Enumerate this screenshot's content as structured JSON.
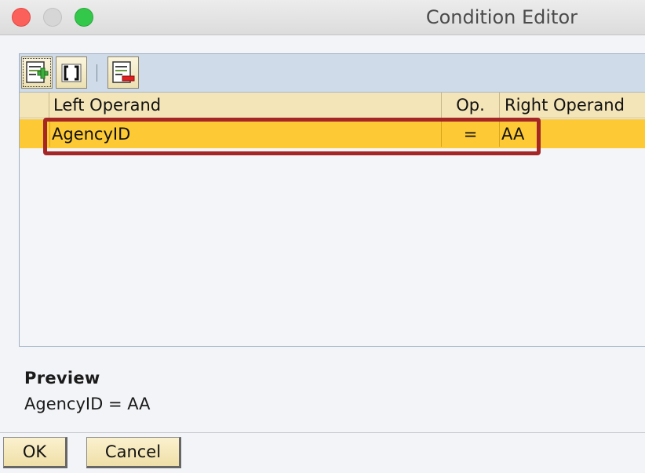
{
  "window": {
    "title": "Condition Editor"
  },
  "toolbar": {
    "buttons": [
      {
        "icon": "add-condition-icon"
      },
      {
        "icon": "brackets-icon"
      },
      {
        "icon": "remove-condition-icon"
      }
    ]
  },
  "table": {
    "columns": {
      "left_operand": "Left Operand",
      "op": "Op.",
      "right_operand": "Right Operand"
    },
    "rows": [
      {
        "left_operand": "AgencyID",
        "op": "=",
        "right_operand": "AA"
      }
    ]
  },
  "preview": {
    "label": "Preview",
    "text": "AgencyID = AA"
  },
  "buttons": {
    "ok": "OK",
    "cancel": "Cancel"
  },
  "colors": {
    "selected_row": "#fdc935",
    "header": "#f4e5b8",
    "toolbar": "#cfdbe8",
    "highlight_border": "#a52626"
  }
}
